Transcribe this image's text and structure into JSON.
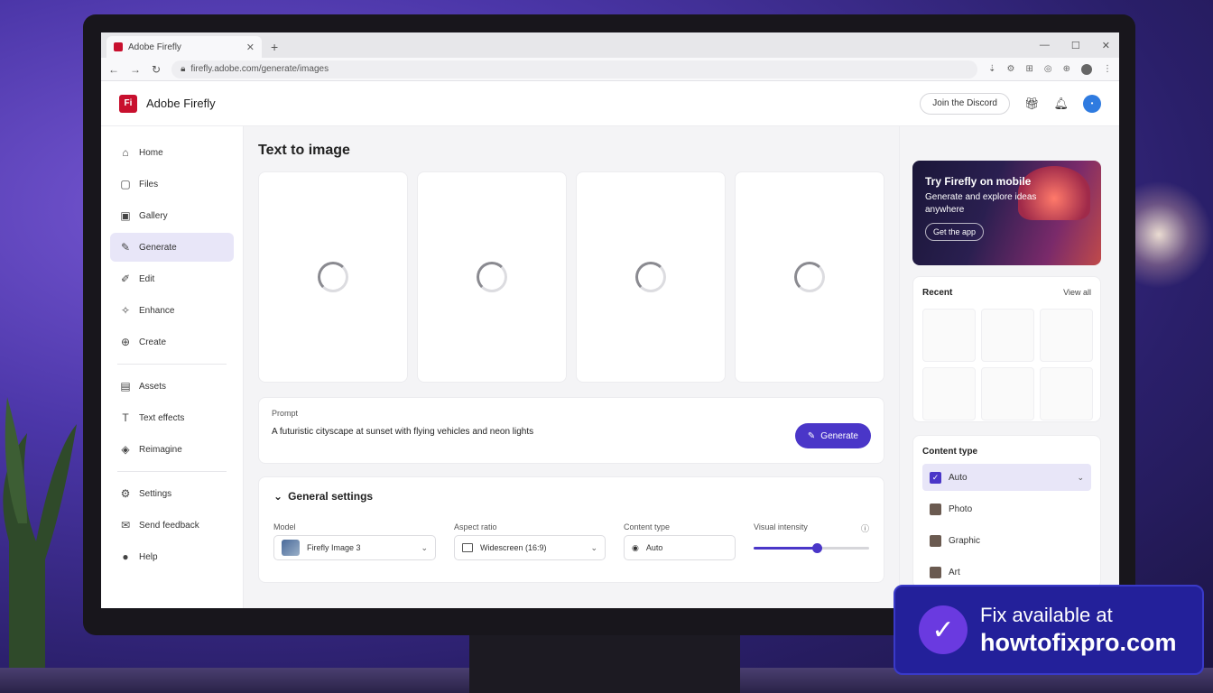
{
  "browser": {
    "tab_title": "Adobe Firefly",
    "url": "firefly.adobe.com/generate/images"
  },
  "header": {
    "brand": "Adobe Firefly",
    "logo_text": "Fi",
    "discord_label": "Join the Discord"
  },
  "sidebar": {
    "items": [
      {
        "label": "Home",
        "icon": "home-icon"
      },
      {
        "label": "Files",
        "icon": "file-icon"
      },
      {
        "label": "Gallery",
        "icon": "gallery-icon"
      },
      {
        "label": "Generate",
        "icon": "generate-icon"
      },
      {
        "label": "Edit",
        "icon": "edit-icon"
      },
      {
        "label": "Enhance",
        "icon": "enhance-icon"
      },
      {
        "label": "Create",
        "icon": "create-icon"
      },
      {
        "label": "Assets",
        "icon": "assets-icon"
      },
      {
        "label": "Text effects",
        "icon": "text-effects-icon"
      },
      {
        "label": "Reimagine",
        "icon": "reimagine-icon"
      },
      {
        "label": "Settings",
        "icon": "gear-icon"
      },
      {
        "label": "Send feedback",
        "icon": "feedback-icon"
      },
      {
        "label": "Help",
        "icon": "help-icon"
      }
    ]
  },
  "main": {
    "title": "Text to image",
    "prompt_label": "Prompt",
    "prompt_text": "A futuristic cityscape at sunset with flying vehicles and neon lights",
    "generate_label": "Generate",
    "settings_title": "General settings",
    "model_label": "Model",
    "model_value": "Firefly Image 3",
    "aspect_label": "Aspect ratio",
    "aspect_value": "Widescreen (16:9)",
    "ctype_label": "Content type",
    "ctype_value": "Auto",
    "intensity_label": "Visual intensity",
    "intensity_fraction": 0.55
  },
  "right": {
    "promo_title": "Try Firefly on mobile",
    "promo_sub": "Generate and explore ideas anywhere",
    "promo_button": "Get the app",
    "recent_title": "Recent",
    "view_all": "View all",
    "content_type_title": "Content type",
    "content_types": [
      "Auto",
      "Photo",
      "Graphic",
      "Art"
    ]
  },
  "banner": {
    "line1": "Fix available at",
    "line2": "howtofixpro.com"
  },
  "colors": {
    "accent": "#4a36c8",
    "brand_red": "#c8102e"
  }
}
